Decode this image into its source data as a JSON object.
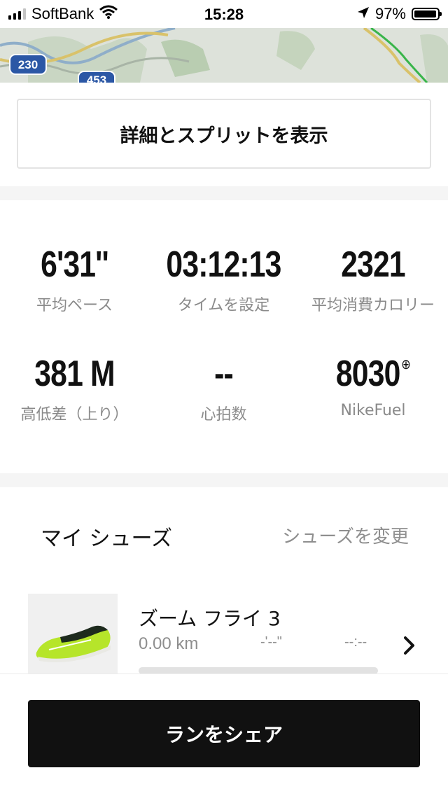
{
  "status_bar": {
    "carrier": "SoftBank",
    "time": "15:28",
    "battery_percent_label": "97%",
    "battery_level": 0.97
  },
  "map": {
    "route_shield_1": "230",
    "route_shield_2": "453"
  },
  "details_button": {
    "label": "詳細とスプリットを表示"
  },
  "stats": [
    {
      "value": "6'31''",
      "label": "平均ペース"
    },
    {
      "value": "03:12:13",
      "label": "タイムを設定"
    },
    {
      "value": "2321",
      "label": "平均消費カロリー"
    },
    {
      "value": "381 M",
      "label": "高低差（上り）"
    },
    {
      "value": "--",
      "label": "心拍数"
    },
    {
      "value": "8030",
      "label": "NikeFuel"
    }
  ],
  "shoes": {
    "title": "マイ シューズ",
    "change_label": "シューズを変更",
    "item": {
      "name": "ズーム フライ 3",
      "distance": "0.00 km",
      "pace": "-'--\"",
      "time": "--:--",
      "progress": 0.0
    }
  },
  "share_button": {
    "label": "ランをシェア"
  },
  "colors": {
    "primary_button": "#111111",
    "secondary_text": "#8e8e8e",
    "band": "#f5f5f5",
    "shoe_accent": "#b6e52a"
  }
}
